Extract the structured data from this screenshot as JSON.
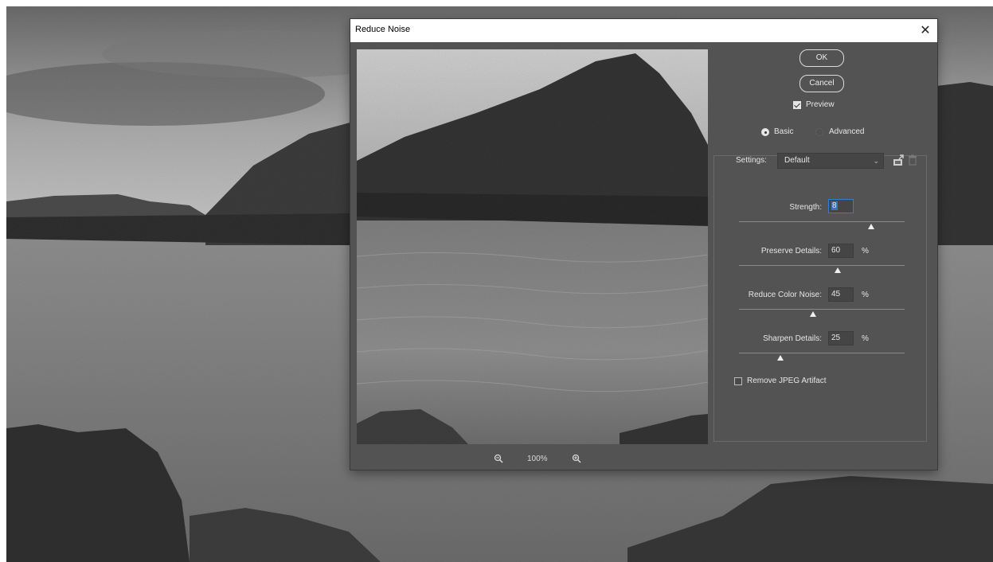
{
  "dialog": {
    "title": "Reduce Noise",
    "close_glyph": "✕",
    "ok_label": "OK",
    "cancel_label": "Cancel",
    "preview": {
      "label": "Preview",
      "checked": true
    },
    "mode": {
      "basic_label": "Basic",
      "advanced_label": "Advanced",
      "selected": "Basic"
    },
    "settings": {
      "label": "Settings:",
      "value": "Default",
      "save_icon": "save-preset-icon",
      "delete_icon": "trash-icon"
    },
    "sliders": [
      {
        "label": "Strength:",
        "value": "8",
        "unit": "",
        "fraction": 0.8
      },
      {
        "label": "Preserve Details:",
        "value": "60",
        "unit": "%",
        "fraction": 0.6
      },
      {
        "label": "Reduce Color Noise:",
        "value": "45",
        "unit": "%",
        "fraction": 0.45
      },
      {
        "label": "Sharpen Details:",
        "value": "25",
        "unit": "%",
        "fraction": 0.25
      }
    ],
    "remove_jpeg": {
      "label": "Remove JPEG Artifact",
      "checked": false
    },
    "zoom": {
      "level": "100%",
      "zoom_out_icon": "zoom-out-icon",
      "zoom_in_icon": "zoom-in-icon"
    }
  },
  "colors": {
    "dialog_bg": "#535353",
    "field_bg": "#454545",
    "focus_accent": "#2e7fd6"
  }
}
